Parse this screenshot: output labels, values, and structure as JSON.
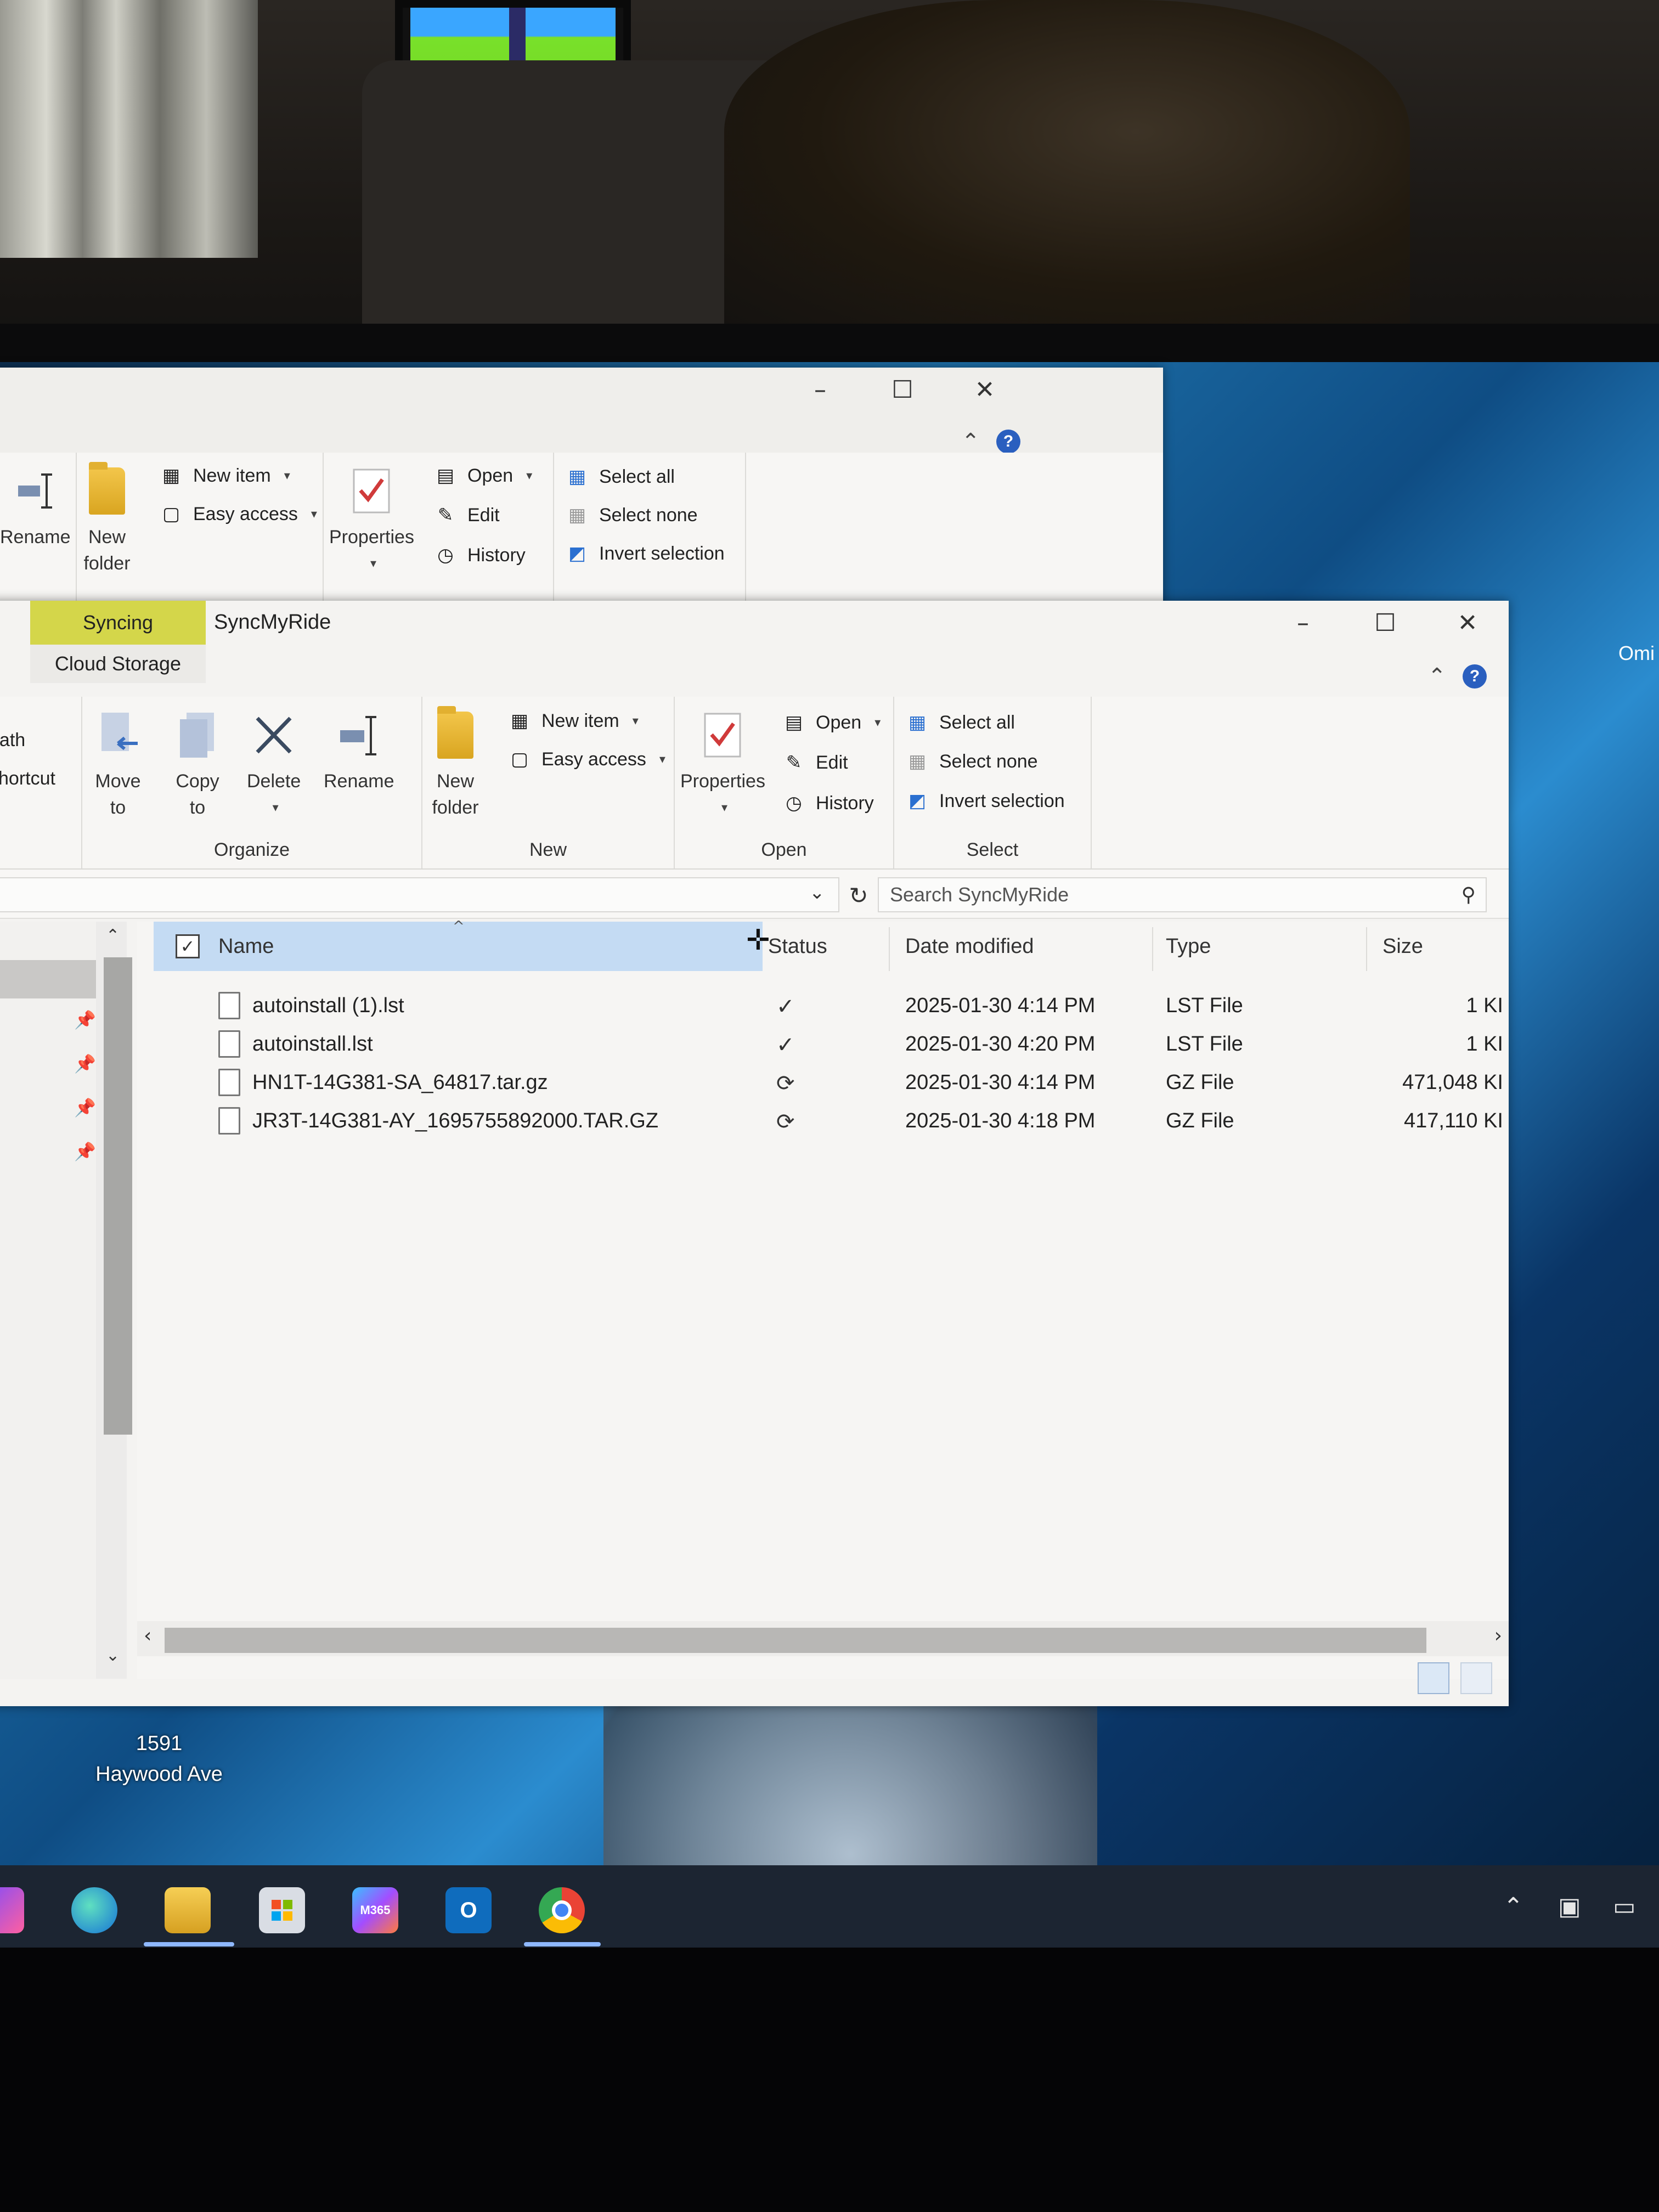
{
  "background_window": {
    "caption": {
      "minimize": "–",
      "maximize": "☐",
      "close": "✕"
    },
    "ribbon": {
      "rename_label": "Rename",
      "new_folder_label": "New\nfolder",
      "new_item_label": "New item",
      "easy_access_label": "Easy access",
      "properties_label": "Properties",
      "open_label": "Open",
      "edit_label": "Edit",
      "history_label": "History",
      "select_all_label": "Select all",
      "select_none_label": "Select none",
      "invert_selection_label": "Invert selection"
    }
  },
  "window": {
    "sync_tab": "Syncing",
    "cloud_tab": "Cloud Storage",
    "title": "SyncMyRide",
    "caption": {
      "minimize": "–",
      "maximize": "☐",
      "close": "✕"
    },
    "help": "?",
    "ribbon": {
      "clipboard": {
        "path_label": "path",
        "shortcut_label": "shortcut"
      },
      "organize": {
        "move_to_label": "Move\nto",
        "copy_to_label": "Copy\nto",
        "delete_label": "Delete",
        "rename_label": "Rename",
        "group_label": "Organize"
      },
      "new": {
        "new_folder_label": "New\nfolder",
        "new_item_label": "New item",
        "easy_access_label": "Easy access",
        "group_label": "New"
      },
      "open": {
        "properties_label": "Properties",
        "open_label": "Open",
        "edit_label": "Edit",
        "history_label": "History",
        "group_label": "Open"
      },
      "select": {
        "select_all_label": "Select all",
        "select_none_label": "Select none",
        "invert_selection_label": "Invert selection",
        "group_label": "Select"
      }
    },
    "search": {
      "placeholder": "Search SyncMyRide"
    },
    "columns": {
      "name": "Name",
      "status": "Status",
      "date_modified": "Date modified",
      "type": "Type",
      "size": "Size"
    },
    "files": [
      {
        "name": "autoinstall (1).lst",
        "status_icon": "✓",
        "status": "synced-check-icon",
        "date": "2025-01-30 4:14 PM",
        "type": "LST File",
        "size": "1 KI"
      },
      {
        "name": "autoinstall.lst",
        "status_icon": "✓",
        "status": "synced-check-icon",
        "date": "2025-01-30 4:20 PM",
        "type": "LST File",
        "size": "1 KI"
      },
      {
        "name": "HN1T-14G381-SA_64817.tar.gz",
        "status_icon": "⟳",
        "status": "syncing-icon",
        "date": "2025-01-30 4:14 PM",
        "type": "GZ File",
        "size": "471,048 KI"
      },
      {
        "name": "JR3T-14G381-AY_1695755892000.TAR.GZ",
        "status_icon": "⟳",
        "status": "syncing-icon",
        "date": "2025-01-30 4:18 PM",
        "type": "GZ File",
        "size": "417,110 KI"
      }
    ]
  },
  "desktop": {
    "omi_label": "Omi",
    "location_number": "1591",
    "location_street": "Haywood Ave"
  },
  "taskbar": {
    "icons": [
      "copilot-icon",
      "edge-icon",
      "file-explorer-icon",
      "store-icon",
      "m365-icon",
      "outlook-icon",
      "chrome-icon"
    ],
    "m365_text": "M365",
    "outlook_text": "O"
  }
}
